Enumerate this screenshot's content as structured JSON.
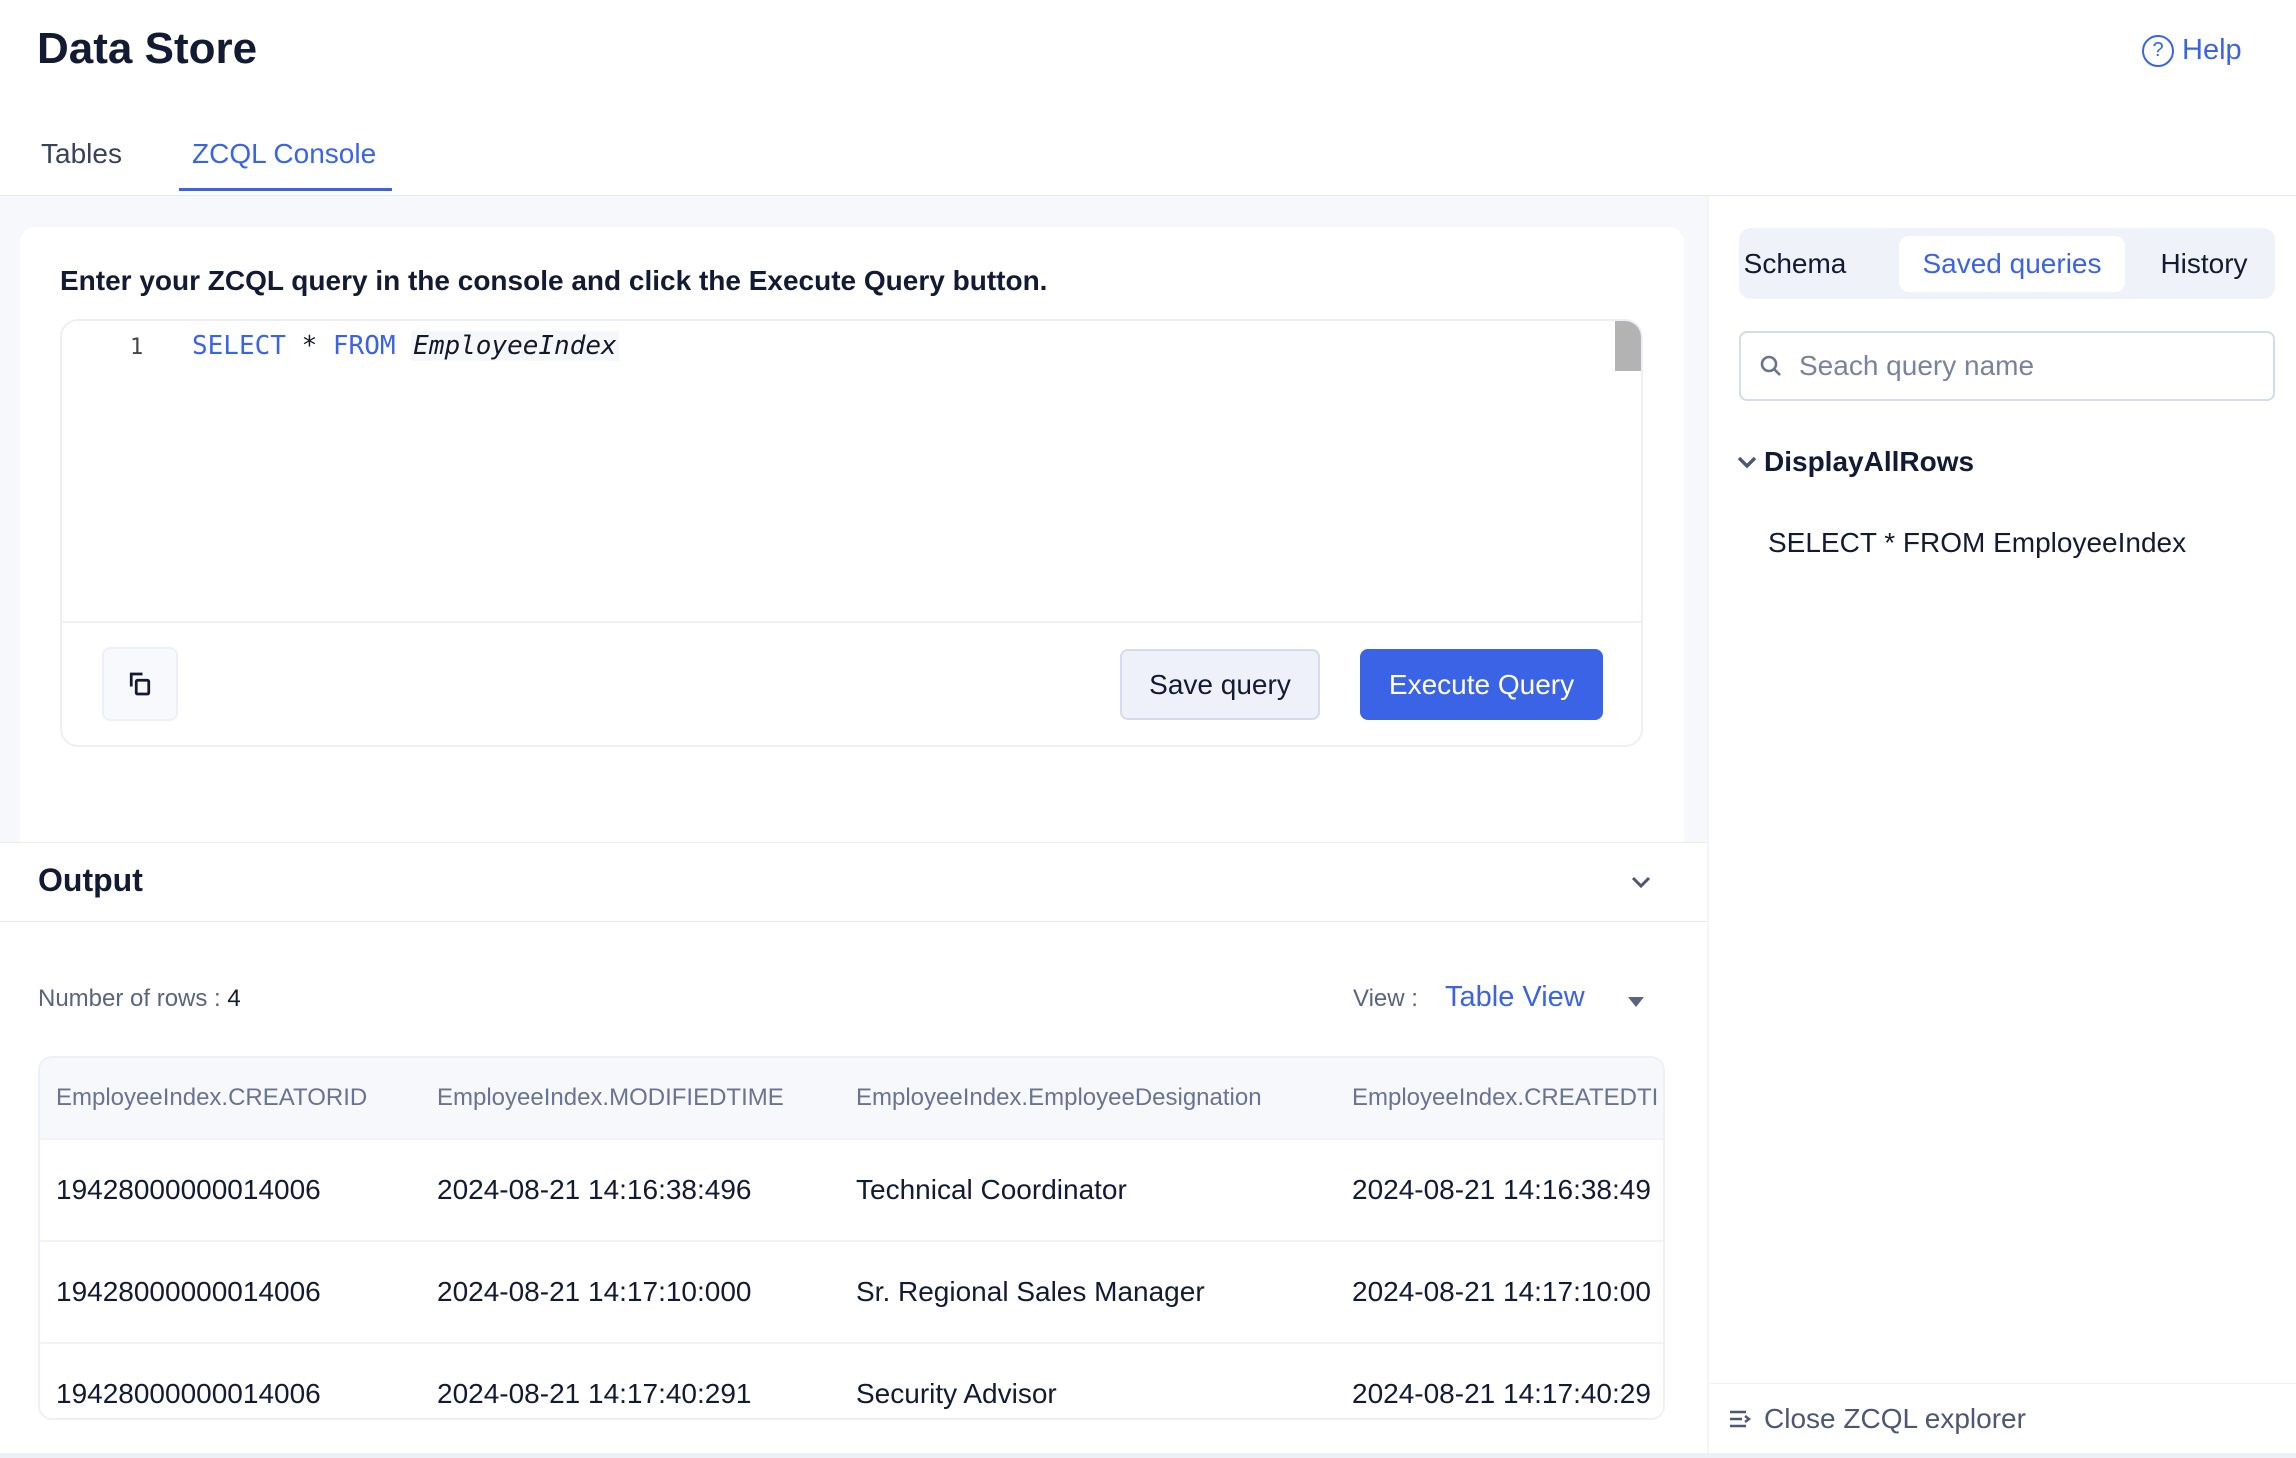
{
  "header": {
    "title": "Data Store",
    "help_label": "Help",
    "help_icon": "question-circle-icon"
  },
  "tabs": [
    {
      "label": "Tables",
      "active": false
    },
    {
      "label": "ZCQL Console",
      "active": true
    }
  ],
  "console": {
    "instruction": "Enter your ZCQL query in the console and click the Execute Query button.",
    "line_number": "1",
    "code": {
      "kw1": "SELECT",
      "star": " * ",
      "kw2": "FROM",
      "table": "EmployeeIndex"
    },
    "copy_icon": "copy-icon",
    "save_label": "Save query",
    "execute_label": "Execute Query"
  },
  "output": {
    "title": "Output",
    "rows_label": "Number of rows : ",
    "rows_count": "4",
    "view_label": "View :",
    "view_value": "Table View",
    "columns": [
      "EmployeeIndex.CREATORID",
      "EmployeeIndex.MODIFIEDTIME",
      "EmployeeIndex.EmployeeDesignation",
      "EmployeeIndex.CREATEDTI"
    ],
    "rows": [
      [
        "19428000000014006",
        "2024-08-21 14:16:38:496",
        "Technical Coordinator",
        "2024-08-21 14:16:38:49"
      ],
      [
        "19428000000014006",
        "2024-08-21 14:17:10:000",
        "Sr. Regional Sales Manager",
        "2024-08-21 14:17:10:00"
      ],
      [
        "19428000000014006",
        "2024-08-21 14:17:40:291",
        "Security Advisor",
        "2024-08-21 14:17:40:29"
      ]
    ]
  },
  "explorer": {
    "tabs": [
      {
        "label": "Schema"
      },
      {
        "label": "Saved queries",
        "active": true
      },
      {
        "label": "History"
      }
    ],
    "search_placeholder": "Seach query name",
    "group_name": "DisplayAllRows",
    "query": "SELECT * FROM EmployeeIndex",
    "close_label": "Close ZCQL explorer"
  },
  "colors": {
    "accent": "#3b63e6",
    "text": "#131a33",
    "muted": "#6a7392"
  }
}
